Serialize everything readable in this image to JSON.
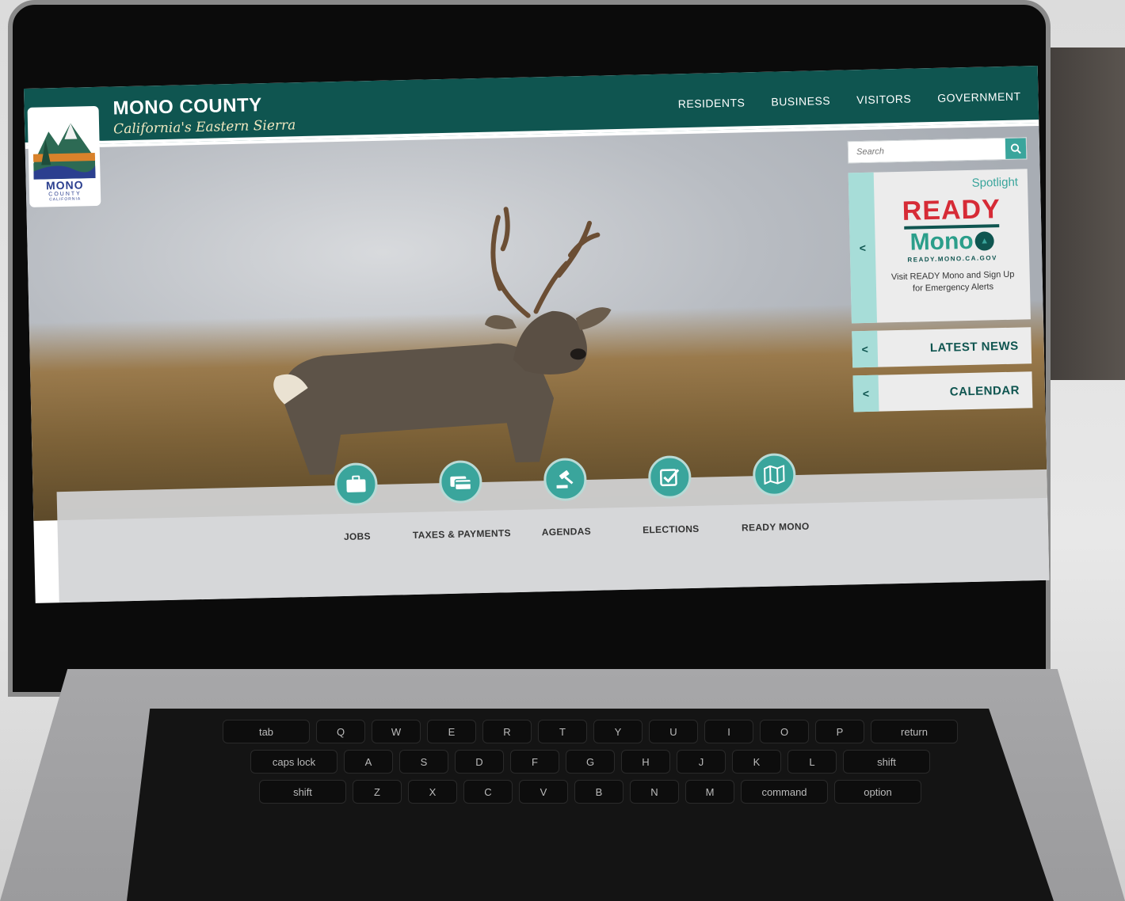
{
  "header": {
    "title": "MONO COUNTY",
    "tagline": "California's Eastern Sierra",
    "logo_mono": "MONO",
    "logo_county": "COUNTY",
    "logo_ca": "CALIFORNIA"
  },
  "nav": {
    "items": [
      "RESIDENTS",
      "BUSINESS",
      "VISITORS",
      "GOVERNMENT"
    ]
  },
  "search": {
    "placeholder": "Search"
  },
  "spotlight": {
    "label": "Spotlight",
    "tab_arrow": "<",
    "ready_word": "READY",
    "mono_word": "Mono",
    "url": "READY.MONO.CA.GOV",
    "caption": "Visit READY Mono and Sign Up for Emergency Alerts"
  },
  "side_cards": [
    {
      "arrow": "<",
      "title": "LATEST NEWS"
    },
    {
      "arrow": "<",
      "title": "CALENDAR"
    }
  ],
  "quicklinks": [
    {
      "label": "JOBS",
      "icon": "briefcase-icon"
    },
    {
      "label": "TAXES & PAYMENTS",
      "icon": "credit-card-icon"
    },
    {
      "label": "AGENDAS",
      "icon": "gavel-icon"
    },
    {
      "label": "ELECTIONS",
      "icon": "checkbox-icon"
    },
    {
      "label": "READY MONO",
      "icon": "map-icon"
    }
  ],
  "keyboard": {
    "row1": [
      "Q",
      "W",
      "E",
      "R",
      "T",
      "Y",
      "U",
      "I",
      "O",
      "P"
    ],
    "row2": [
      "A",
      "S",
      "D",
      "F",
      "G",
      "H",
      "J",
      "K",
      "L"
    ],
    "row3": [
      "Z",
      "X",
      "C",
      "V",
      "B",
      "N",
      "M"
    ],
    "mod_left1": "tab",
    "mod_left2": "caps lock",
    "mod_left3": "shift",
    "mod_right1": "return",
    "mod_right2": "shift",
    "mod_bottom1": "command",
    "mod_bottom2": "option"
  },
  "colors": {
    "brand_teal": "#0f5550",
    "accent_teal": "#3aa59c",
    "ready_red": "#d62b36"
  }
}
